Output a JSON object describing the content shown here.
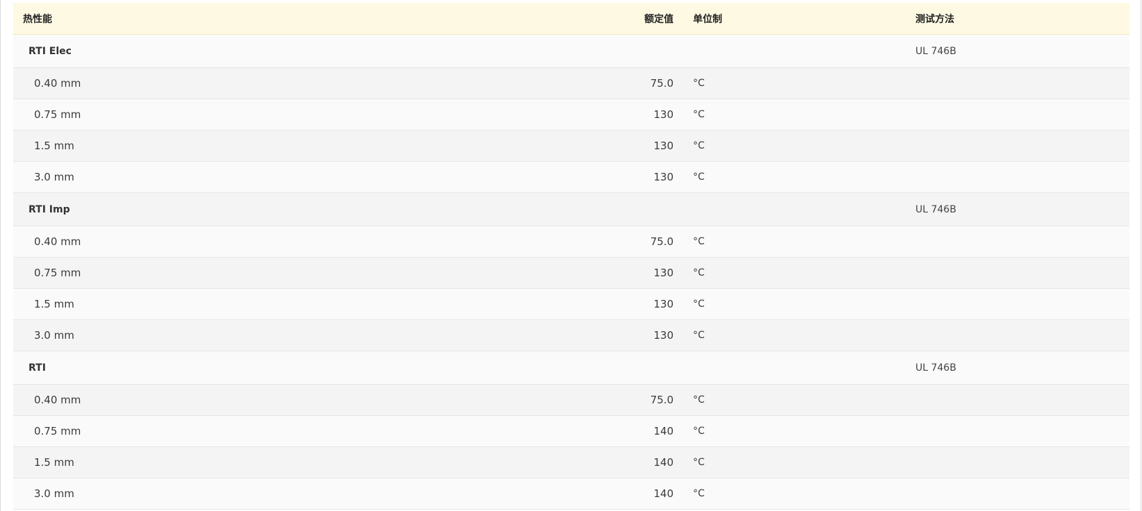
{
  "header": {
    "property": "热性能",
    "value": "额定值",
    "unit": "单位制",
    "method": "测试方法"
  },
  "groups": [
    {
      "name": "RTI Elec",
      "method": "UL 746B",
      "rows": [
        {
          "thickness": "0.40 mm",
          "value": "75.0",
          "unit": "°C"
        },
        {
          "thickness": "0.75 mm",
          "value": "130",
          "unit": "°C"
        },
        {
          "thickness": "1.5 mm",
          "value": "130",
          "unit": "°C"
        },
        {
          "thickness": "3.0 mm",
          "value": "130",
          "unit": "°C"
        }
      ]
    },
    {
      "name": "RTI Imp",
      "method": "UL 746B",
      "rows": [
        {
          "thickness": "0.40 mm",
          "value": "75.0",
          "unit": "°C"
        },
        {
          "thickness": "0.75 mm",
          "value": "130",
          "unit": "°C"
        },
        {
          "thickness": "1.5 mm",
          "value": "130",
          "unit": "°C"
        },
        {
          "thickness": "3.0 mm",
          "value": "130",
          "unit": "°C"
        }
      ]
    },
    {
      "name": "RTI",
      "method": "UL 746B",
      "rows": [
        {
          "thickness": "0.40 mm",
          "value": "75.0",
          "unit": "°C"
        },
        {
          "thickness": "0.75 mm",
          "value": "140",
          "unit": "°C"
        },
        {
          "thickness": "1.5 mm",
          "value": "140",
          "unit": "°C"
        },
        {
          "thickness": "3.0 mm",
          "value": "140",
          "unit": "°C"
        }
      ]
    }
  ]
}
